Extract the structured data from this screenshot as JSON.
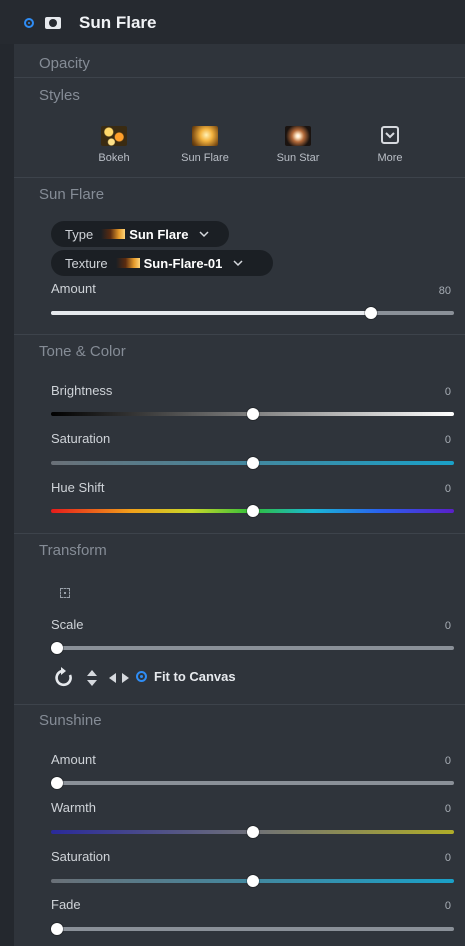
{
  "header": {
    "title": "Sun Flare"
  },
  "opacity": {
    "label": "Opacity"
  },
  "styles": {
    "title": "Styles",
    "items": [
      {
        "label": "Bokeh",
        "icon": "bokeh-thumb"
      },
      {
        "label": "Sun Flare",
        "icon": "sun-flare-thumb"
      },
      {
        "label": "Sun Star",
        "icon": "sun-star-thumb"
      },
      {
        "label": "More",
        "icon": "chevron-down-box-icon"
      }
    ]
  },
  "sun_flare": {
    "title": "Sun Flare",
    "type_label": "Type",
    "type_value": "Sun Flare",
    "texture_label": "Texture",
    "texture_value": "Sun-Flare-01",
    "amount_label": "Amount",
    "amount_value": "80",
    "amount_level": 0.79
  },
  "tone": {
    "title": "Tone & Color",
    "brightness_label": "Brightness",
    "brightness_value": "0",
    "saturation_label": "Saturation",
    "saturation_value": "0",
    "hue_label": "Hue Shift",
    "hue_value": "0"
  },
  "transform": {
    "title": "Transform",
    "scale_label": "Scale",
    "scale_value": "0",
    "fit_label": "Fit to Canvas"
  },
  "sunshine": {
    "title": "Sunshine",
    "amount_label": "Amount",
    "amount_value": "0",
    "warmth_label": "Warmth",
    "warmth_value": "0",
    "saturation_label": "Saturation",
    "saturation_value": "0",
    "fade_label": "Fade",
    "fade_value": "0"
  },
  "colors": {
    "accent": "#2f8df5",
    "panel": "#2f343b",
    "saturation_track": "#1aa0c8"
  }
}
